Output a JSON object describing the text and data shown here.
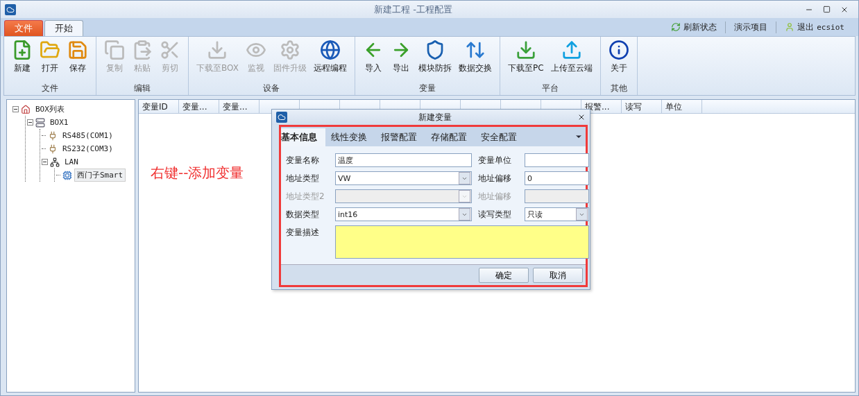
{
  "window": {
    "title": "新建工程 -工程配置"
  },
  "file_button": {
    "label": "文件"
  },
  "menu_tabs": [
    {
      "label": "开始",
      "selected": true
    }
  ],
  "top_links": [
    {
      "label": "刷新状态",
      "kind": "refresh"
    },
    {
      "label": "演示项目",
      "kind": "plain"
    },
    {
      "label": "退出",
      "kind": "user",
      "user": "ecsiot"
    }
  ],
  "ribbon": {
    "groups": [
      {
        "label": "文件",
        "buttons": [
          {
            "label": "新建",
            "kind": "new",
            "disabled": false
          },
          {
            "label": "打开",
            "kind": "open",
            "disabled": false
          },
          {
            "label": "保存",
            "kind": "save",
            "disabled": false
          }
        ]
      },
      {
        "label": "编辑",
        "buttons": [
          {
            "label": "复制",
            "kind": "copy",
            "disabled": true
          },
          {
            "label": "粘贴",
            "kind": "paste",
            "disabled": true
          },
          {
            "label": "剪切",
            "kind": "cut",
            "disabled": true
          }
        ]
      },
      {
        "label": "设备",
        "buttons": [
          {
            "label": "下载至BOX",
            "kind": "download",
            "disabled": true
          },
          {
            "label": "监视",
            "kind": "eye",
            "disabled": true
          },
          {
            "label": "固件升级",
            "kind": "gear",
            "disabled": true
          },
          {
            "label": "远程编程",
            "kind": "globe",
            "disabled": false
          }
        ]
      },
      {
        "label": "变量",
        "buttons": [
          {
            "label": "导入",
            "kind": "import",
            "disabled": false
          },
          {
            "label": "导出",
            "kind": "export",
            "disabled": false
          },
          {
            "label": "模块防拆",
            "kind": "shield",
            "disabled": false
          },
          {
            "label": "数据交换",
            "kind": "exchange",
            "disabled": false
          }
        ]
      },
      {
        "label": "平台",
        "buttons": [
          {
            "label": "下载至PC",
            "kind": "down",
            "disabled": false
          },
          {
            "label": "上传至云端",
            "kind": "up",
            "disabled": false
          }
        ]
      },
      {
        "label": "其他",
        "buttons": [
          {
            "label": "关于",
            "kind": "info",
            "disabled": false
          }
        ]
      }
    ]
  },
  "tree": [
    {
      "label": "BOX列表",
      "kind": "home",
      "expanded": true,
      "selected": false,
      "children": [
        {
          "label": "BOX1",
          "kind": "box",
          "expanded": true,
          "selected": false,
          "children": [
            {
              "label": "RS485(COM1)",
              "kind": "port",
              "selected": false
            },
            {
              "label": "RS232(COM3)",
              "kind": "port",
              "selected": false
            },
            {
              "label": "LAN",
              "kind": "lan",
              "expanded": true,
              "selected": false,
              "children": [
                {
                  "label": "西门子Smart",
                  "kind": "plc",
                  "selected": true
                }
              ]
            }
          ]
        }
      ]
    }
  ],
  "table": {
    "columns": [
      "变量ID",
      "变量...",
      "变量...",
      "报警...",
      "读写",
      "单位"
    ]
  },
  "annotation": "右键--添加变量",
  "dialog": {
    "title": "新建变量",
    "tabs": [
      {
        "label": "基本信息",
        "selected": true
      },
      {
        "label": "线性变换",
        "selected": false
      },
      {
        "label": "报警配置",
        "selected": false
      },
      {
        "label": "存储配置",
        "selected": false
      },
      {
        "label": "安全配置",
        "selected": false
      }
    ],
    "fields": [
      {
        "label": "变量名称",
        "kind": "text",
        "value": "温度",
        "disabled": false
      },
      {
        "label": "变量单位",
        "kind": "text",
        "disabled": false
      },
      {
        "label": "地址类型",
        "kind": "select",
        "value": "VW",
        "disabled": false
      },
      {
        "label": "地址偏移",
        "kind": "text",
        "value": "0",
        "disabled": false
      },
      {
        "label": "地址类型2",
        "kind": "select",
        "disabled": true
      },
      {
        "label": "地址偏移",
        "kind": "text",
        "disabled": true
      },
      {
        "label": "数据类型",
        "kind": "select",
        "value": "int16",
        "disabled": false
      },
      {
        "label": "读写类型",
        "kind": "select",
        "value": "只读",
        "disabled": false
      },
      {
        "label": "变量描述",
        "kind": "textarea",
        "disabled": false
      }
    ],
    "buttons": [
      "确定",
      "取消"
    ]
  }
}
